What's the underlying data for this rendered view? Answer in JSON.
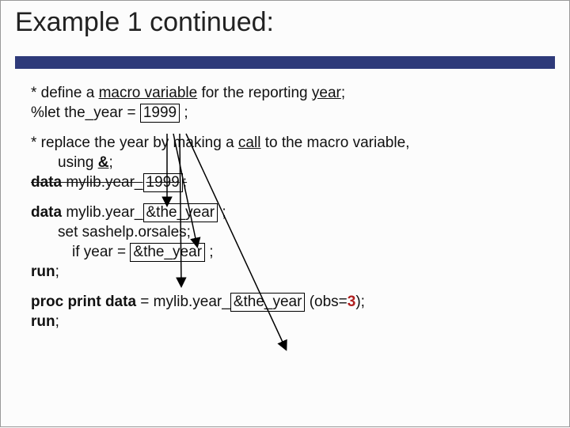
{
  "title": "Example 1 continued:",
  "lines": {
    "l1a": "* define a ",
    "l1b": "macro variable",
    "l1c": " for the reporting ",
    "l1d": "year",
    "l1e": ";",
    "l2a": "%let the_year = ",
    "l2b": "1999",
    "l2c": " ;",
    "l3a": "* replace the year by making a ",
    "l3b": "call",
    "l3c": " to the macro variable,",
    "l3d": "using ",
    "l3e": "&",
    "l3f": ";",
    "l4a": "data",
    "l4b": " mylib.year_",
    "l4c": "1999",
    "l4d": ";",
    "l5a": "data",
    "l5b": " mylib.year_",
    "l5c": "&the_year",
    "l5d": " ;",
    "l6a": "set sashelp.orsales;",
    "l7a": "if year = ",
    "l7b": "&the_year",
    "l7c": " ;",
    "l8a": "run",
    "l8b": ";",
    "l9a": "proc print data",
    "l9b": " =  mylib.year_",
    "l9c": "&the_year",
    "l9d": " (obs=",
    "l9e": "3",
    "l9f": ");",
    "l10a": "run",
    "l10b": ";"
  }
}
